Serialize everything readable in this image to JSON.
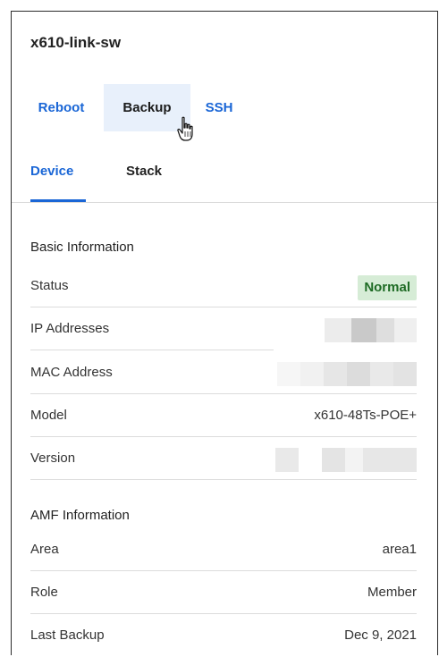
{
  "device": {
    "title": "x610-link-sw"
  },
  "actions": {
    "reboot": "Reboot",
    "backup": "Backup",
    "ssh": "SSH"
  },
  "tabs": {
    "device": "Device",
    "stack": "Stack"
  },
  "basic_info": {
    "heading": "Basic Information",
    "status_label": "Status",
    "status_value": "Normal",
    "ip_label": "IP Addresses",
    "mac_label": "MAC Address",
    "model_label": "Model",
    "model_value": "x610-48Ts-POE+",
    "version_label": "Version"
  },
  "amf_info": {
    "heading": "AMF Information",
    "area_label": "Area",
    "area_value": "area1",
    "role_label": "Role",
    "role_value": "Member",
    "last_backup_label": "Last Backup",
    "last_backup_value": "Dec 9, 2021"
  },
  "colors": {
    "accent": "#1a66d6",
    "status_bg": "#d6ecd6",
    "status_text": "#1e6b24"
  }
}
